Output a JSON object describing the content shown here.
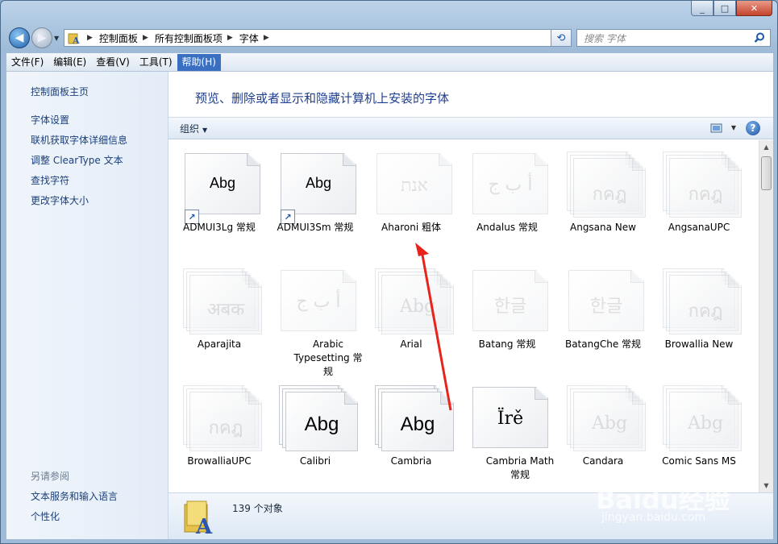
{
  "window": {
    "caption_buttons": [
      "_",
      "□",
      "✕"
    ]
  },
  "address": {
    "crumbs": [
      "控制面板",
      "所有控制面板项",
      "字体"
    ]
  },
  "search": {
    "placeholder": "搜索 字体"
  },
  "menu": {
    "items": [
      "文件(F)",
      "编辑(E)",
      "查看(V)",
      "工具(T)",
      "帮助(H)"
    ],
    "active_index": 4
  },
  "sidebar": {
    "main_link": "控制面板主页",
    "links": [
      "字体设置",
      "联机获取字体详细信息",
      "调整 ClearType 文本",
      "查找字符",
      "更改字体大小"
    ],
    "see_also_title": "另请参阅",
    "see_also": [
      "文本服务和输入语言",
      "个性化"
    ]
  },
  "content": {
    "heading": "预览、删除或者显示和隐藏计算机上安装的字体",
    "organize": "组织",
    "fonts": [
      {
        "name": "ADMUI3Lg 常规",
        "sample": "Abg",
        "dim": false,
        "shortcut": true,
        "stack": false
      },
      {
        "name": "ADMUI3Sm 常规",
        "sample": "Abg",
        "dim": false,
        "shortcut": true,
        "stack": false
      },
      {
        "name": "Aharoni 粗体",
        "sample": "אנת",
        "dim": true,
        "shortcut": false,
        "stack": false
      },
      {
        "name": "Andalus 常规",
        "sample": "أ ب ج",
        "dim": true,
        "shortcut": false,
        "stack": false
      },
      {
        "name": "Angsana New",
        "sample": "กคฎ",
        "dim": true,
        "shortcut": false,
        "stack": true
      },
      {
        "name": "AngsanaUPC",
        "sample": "กคฎ",
        "dim": true,
        "shortcut": false,
        "stack": true
      },
      {
        "name": "Aparajita",
        "sample": "अबक",
        "dim": true,
        "shortcut": false,
        "stack": true
      },
      {
        "name": "Arabic Typesetting 常规",
        "sample": "أ ب ج",
        "dim": true,
        "shortcut": false,
        "stack": false
      },
      {
        "name": "Arial",
        "sample": "Abg",
        "dim": true,
        "shortcut": false,
        "stack": true
      },
      {
        "name": "Batang 常规",
        "sample": "한글",
        "dim": true,
        "shortcut": false,
        "stack": false
      },
      {
        "name": "BatangChe 常规",
        "sample": "한글",
        "dim": true,
        "shortcut": false,
        "stack": false
      },
      {
        "name": "Browallia New",
        "sample": "กคฎ",
        "dim": true,
        "shortcut": false,
        "stack": true
      },
      {
        "name": "BrowalliaUPC",
        "sample": "กคฎ",
        "dim": true,
        "shortcut": false,
        "stack": true
      },
      {
        "name": "Calibri",
        "sample": "Abg",
        "dim": false,
        "shortcut": false,
        "stack": true
      },
      {
        "name": "Cambria",
        "sample": "Abg",
        "dim": false,
        "shortcut": false,
        "stack": true
      },
      {
        "name": "Cambria Math 常规",
        "sample": "Ïrě",
        "dim": false,
        "shortcut": false,
        "stack": false
      },
      {
        "name": "Candara",
        "sample": "Abg",
        "dim": true,
        "shortcut": false,
        "stack": true
      },
      {
        "name": "Comic Sans MS",
        "sample": "Abg",
        "dim": true,
        "shortcut": false,
        "stack": true
      }
    ]
  },
  "status": {
    "count_text": "139 个对象"
  },
  "watermark": {
    "brand": "Baidu经验",
    "url": "jingyan.baidu.com"
  },
  "colors": {
    "accent": "#3a6fc2",
    "link": "#1a3f7a",
    "heading": "#1e3f8f",
    "arrow": "#e8231b"
  }
}
